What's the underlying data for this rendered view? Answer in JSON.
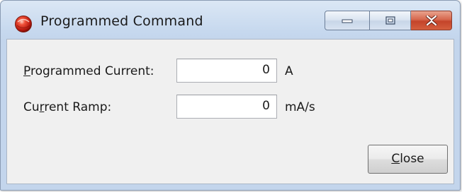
{
  "window": {
    "title": "Programmed Command",
    "icon": "app-red-orb-icon",
    "caption_buttons": {
      "minimize_icon": "minimize-icon",
      "maximize_icon": "maximize-icon",
      "close_icon": "close-icon",
      "close_color": "#c4442a"
    }
  },
  "form": {
    "programmed_current": {
      "label_accel": "P",
      "label_rest": "rogrammed Current:",
      "value": "0",
      "unit": "A"
    },
    "current_ramp": {
      "label_pre": "Cu",
      "label_accel": "r",
      "label_rest": "rent Ramp:",
      "value": "0",
      "unit": "mA/s"
    }
  },
  "buttons": {
    "close_accel": "C",
    "close_rest": "lose"
  }
}
